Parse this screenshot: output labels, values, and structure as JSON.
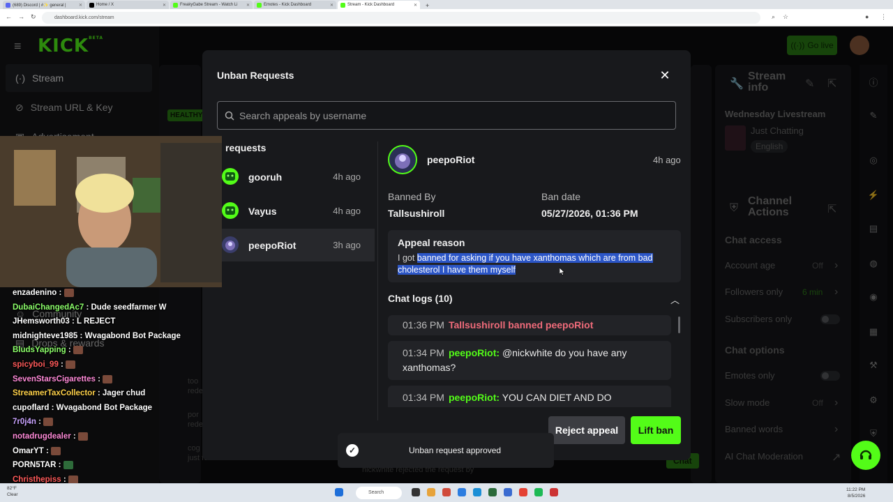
{
  "browser": {
    "tabs": [
      {
        "label": "(689) Discord | #✨ general |",
        "active": false,
        "color": "#5865f2"
      },
      {
        "label": "Home / X",
        "active": false,
        "color": "#000000"
      },
      {
        "label": "FreakyGabe Stream - Watch Li",
        "active": false,
        "color": "#53fc18"
      },
      {
        "label": "Emotes - Kick Dashboard",
        "active": false,
        "color": "#53fc18"
      },
      {
        "label": "Stream - Kick Dashboard",
        "active": true,
        "color": "#53fc18"
      }
    ],
    "new_tab": "+",
    "url": "dashboard.kick.com/stream"
  },
  "dashboard": {
    "logo": "KICK",
    "logo_badge": "BETA",
    "go_live": "Go live",
    "sidebar": [
      {
        "label": "Stream",
        "icon": "stream-icon",
        "active": true
      },
      {
        "label": "Stream URL & Key",
        "icon": "link-icon",
        "active": false
      },
      {
        "label": "Advertisement",
        "icon": "ad-icon",
        "active": false
      },
      {
        "label": "Community",
        "icon": "community-icon",
        "active": false
      },
      {
        "label": "Drops & rewards",
        "icon": "gift-icon",
        "active": false
      }
    ],
    "bg_health": "HEALTHY",
    "stream_info": {
      "title": "Stream info",
      "stream_title": "Wednesday Livestream",
      "category": "Just Chatting",
      "language": "English"
    },
    "channel_actions": {
      "title": "Channel Actions",
      "chat_access": "Chat access",
      "rows": [
        {
          "label": "Account age",
          "value": "Off"
        },
        {
          "label": "Followers only",
          "value": "6 min"
        },
        {
          "label": "Subscribers only",
          "value": ""
        }
      ],
      "chat_options": "Chat options",
      "options": [
        {
          "label": "Emotes only",
          "value": ""
        },
        {
          "label": "Slow mode",
          "value": "Off"
        },
        {
          "label": "Banned words",
          "value": ""
        },
        {
          "label": "AI Chat Moderation",
          "value": ""
        }
      ]
    },
    "activity_partial": [
      {
        "line1": "too",
        "line2": "rede"
      },
      {
        "line1": "por",
        "line2": "rede"
      },
      {
        "line1": "cog",
        "line2": "just followed the channel"
      }
    ],
    "mod_line": "nickwhite rejected the request by",
    "chat_button": "Chat"
  },
  "modal": {
    "title": "Unban Requests",
    "search_placeholder": "Search appeals by username",
    "requests_heading": "requests",
    "requests": [
      {
        "name": "gooruh",
        "time": "4h ago",
        "selected": false
      },
      {
        "name": "Vayus",
        "time": "4h ago",
        "selected": false
      },
      {
        "name": "peepoRiot",
        "time": "3h ago",
        "selected": true
      }
    ],
    "detail": {
      "username": "peepoRiot",
      "time": "4h ago",
      "banned_by_label": "Banned By",
      "banned_by": "Tallsushiroll",
      "ban_date_label": "Ban date",
      "ban_date": "05/27/2026, 01:36 PM",
      "appeal_label": "Appeal reason",
      "appeal_prefix": "I got ",
      "appeal_highlight": "banned for asking if you have xanthomas which are from bad cholesterol I have them myself",
      "chat_logs_label": "Chat logs (10)",
      "logs": [
        {
          "time": "01:36 PM",
          "user": "Tallsushiroll banned peepoRiot",
          "text": "",
          "type": "ban"
        },
        {
          "time": "01:34 PM",
          "user": "peepoRiot:",
          "text": "@nickwhite do you have any xanthomas?",
          "type": "msg"
        },
        {
          "time": "01:34 PM",
          "user": "peepoRiot:",
          "text": "YOU CAN DIET AND DO EVERYTHING AND STILL HAVE BAD CHOLESTEROL",
          "type": "msg"
        }
      ]
    },
    "reject_label": "Reject appeal",
    "lift_label": "Lift ban"
  },
  "toast": {
    "text": "Unban request approved"
  },
  "chat_overlay": [
    {
      "user": "enzadenino",
      "color": "#ffffff",
      "msg": ""
    },
    {
      "user": "DubaiChangedAc7",
      "color": "#8cff6a",
      "msg": "Dude seedfarmer W"
    },
    {
      "user": "JHemsworth03",
      "color": "#ffffff",
      "msg": "L REJECT"
    },
    {
      "user": "midnighteve1985",
      "color": "#ffffff",
      "msg": "Wvagabond Bot Package"
    },
    {
      "user": "BludsYapping",
      "color": "#8cff6a",
      "msg": ""
    },
    {
      "user": "spicyboi_99",
      "color": "#ff5a5a",
      "msg": ""
    },
    {
      "user": "SevenStarsCigarettes",
      "color": "#ff8ad8",
      "msg": ""
    },
    {
      "user": "StreamerTaxCollector",
      "color": "#ffd24a",
      "msg": "Jager chud"
    },
    {
      "user": "cupoflard",
      "color": "#ffffff",
      "msg": "Wvagabond Bot Package"
    },
    {
      "user": "7r0j4n",
      "color": "#c9a3ff",
      "msg": ""
    },
    {
      "user": "notadrugdealer",
      "color": "#ff8ad8",
      "msg": ""
    },
    {
      "user": "OmarYT",
      "color": "#ffffff",
      "msg": ""
    },
    {
      "user": "PORN5TAR",
      "color": "#ffffff",
      "msg": ""
    },
    {
      "user": "Christhepiss",
      "color": "#ff5a5a",
      "msg": ""
    }
  ],
  "taskbar": {
    "weather": "82°F",
    "weather_sub": "Clear",
    "search": "Search",
    "time": "11:22 PM",
    "date": "8/5/2026"
  },
  "colors": {
    "accent": "#53fc18",
    "ban": "#f06b7a",
    "highlight": "#2c56c7"
  }
}
